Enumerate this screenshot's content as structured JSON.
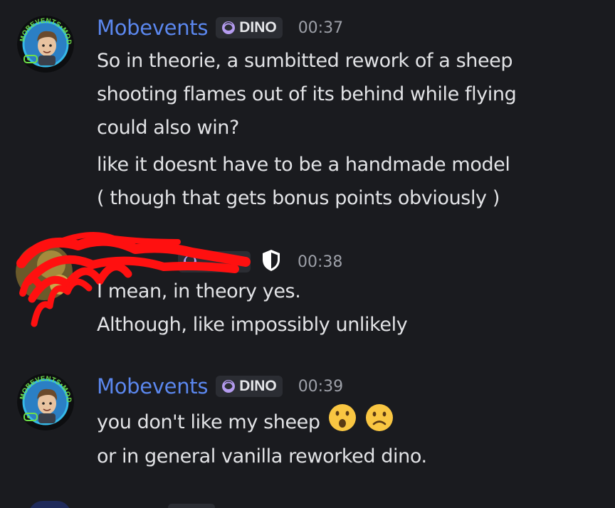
{
  "messages": [
    {
      "author": "Mobevents",
      "tag": "DINO",
      "time": "00:37",
      "lines": [
        "So in theorie, a sumbitted rework of a sheep",
        "shooting flames out of its behind while flying",
        "could also win?",
        "like it doesnt have to be a handmade model",
        "( though that gets bonus points obviously )"
      ],
      "avatar_text": "MOBEVENTS•MODS",
      "avatar_icon": "gamepad-icon"
    },
    {
      "author": "",
      "tag": "",
      "time": "00:38",
      "lines": [
        "I mean, in theory yes.",
        "Although, like impossibly unlikely"
      ],
      "badge_icon": "shield-icon"
    },
    {
      "author": "Mobevents",
      "tag": "DINO",
      "time": "00:39",
      "lines": [
        "you don't like my sheep",
        "or in general vanilla reworked dino."
      ],
      "emojis": [
        "hushed-face-icon",
        "slightly-frowning-face-icon"
      ],
      "avatar_text": "MOBEVENTS•MODS",
      "avatar_icon": "gamepad-icon"
    }
  ],
  "colors": {
    "background": "#1a1b1f",
    "username": "#5b87ee",
    "text": "#e2e3e6",
    "timestamp": "#9da0a8",
    "tag_bg": "#2b2d33",
    "tag_icon": "#b59cf0",
    "avatar_ring": "#35b9e8",
    "avatar_text": "#6ee04a",
    "redaction": "#ff1010"
  }
}
